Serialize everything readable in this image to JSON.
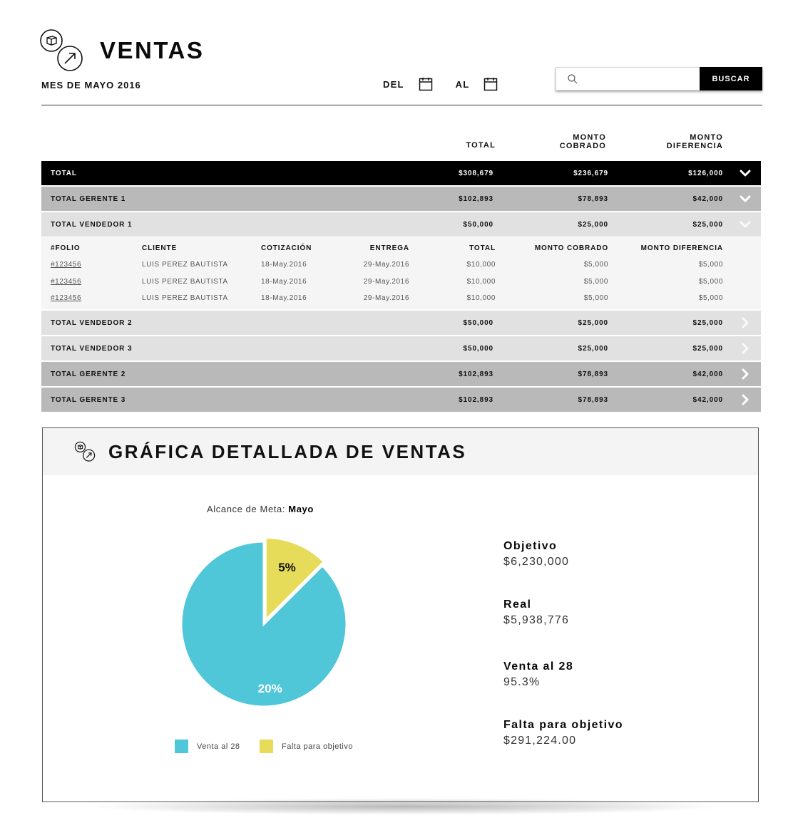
{
  "header": {
    "title": "VENTAS",
    "month": "MES DE MAYO 2016",
    "del_label": "DEL",
    "al_label": "AL",
    "search_placeholder": "",
    "search_button": "BUSCAR"
  },
  "columns": {
    "total": "TOTAL",
    "monto_cobrado_1": "MONTO",
    "monto_cobrado_2": "COBRADO",
    "monto_diferencia_1": "MONTO",
    "monto_diferencia_2": "DIFERENCIA"
  },
  "rows": [
    {
      "label": "TOTAL",
      "total": "$308,679",
      "cobrado": "$236,679",
      "diferencia": "$126,000",
      "style": "black",
      "chevron": "chevron-down-icon"
    },
    {
      "label": "TOTAL GERENTE 1",
      "total": "$102,893",
      "cobrado": "$78,893",
      "diferencia": "$42,000",
      "style": "dark",
      "chevron": "chevron-down-icon"
    },
    {
      "label": "TOTAL VENDEDOR 1",
      "total": "$50,000",
      "cobrado": "$25,000",
      "diferencia": "$25,000",
      "style": "light",
      "chevron": "chevron-down-icon"
    },
    {
      "label": "TOTAL VENDEDOR 2",
      "total": "$50,000",
      "cobrado": "$25,000",
      "diferencia": "$25,000",
      "style": "light",
      "chevron": "chevron-right-icon"
    },
    {
      "label": "TOTAL VENDEDOR 3",
      "total": "$50,000",
      "cobrado": "$25,000",
      "diferencia": "$25,000",
      "style": "light",
      "chevron": "chevron-right-icon"
    },
    {
      "label": "TOTAL GERENTE 2",
      "total": "$102,893",
      "cobrado": "$78,893",
      "diferencia": "$42,000",
      "style": "dark",
      "chevron": "chevron-right-icon"
    },
    {
      "label": "TOTAL GERENTE 3",
      "total": "$102,893",
      "cobrado": "$78,893",
      "diferencia": "$42,000",
      "style": "dark",
      "chevron": "chevron-right-icon"
    }
  ],
  "detail": {
    "headers": {
      "folio": "#FOLIO",
      "cliente": "CLIENTE",
      "cotizacion": "COTIZACIÓN",
      "entrega": "ENTREGA",
      "total": "TOTAL",
      "cobrado": "MONTO COBRADO",
      "diferencia": "MONTO DIFERENCIA"
    },
    "items": [
      {
        "folio": "#123456",
        "cliente": "LUIS PEREZ BAUTISTA",
        "cotizacion": "18-May.2016",
        "entrega": "29-May.2016",
        "total": "$10,000",
        "cobrado": "$5,000",
        "diferencia": "$5,000"
      },
      {
        "folio": "#123456",
        "cliente": "LUIS PEREZ BAUTISTA",
        "cotizacion": "18-May.2016",
        "entrega": "29-May.2016",
        "total": "$10,000",
        "cobrado": "$5,000",
        "diferencia": "$5,000"
      },
      {
        "folio": "#123456",
        "cliente": "LUIS PEREZ BAUTISTA",
        "cotizacion": "18-May.2016",
        "entrega": "29-May.2016",
        "total": "$10,000",
        "cobrado": "$5,000",
        "diferencia": "$5,000"
      }
    ]
  },
  "chart_panel": {
    "title": "GRÁFICA DETALLADA DE VENTAS",
    "caption_prefix": "Alcance de Meta:",
    "caption_month": "Mayo",
    "legend": [
      {
        "label": "Venta al 28",
        "color": "#50c7d9"
      },
      {
        "label": "Falta para objetivo",
        "color": "#e6dc5a"
      }
    ],
    "stats": [
      {
        "label": "Objetivo",
        "value": "$6,230,000"
      },
      {
        "label": "Real",
        "value": "$5,938,776"
      },
      {
        "label": "Venta al 28",
        "value": "95.3%"
      },
      {
        "label": "Falta para objetivo",
        "value": "$291,224.00"
      }
    ]
  },
  "chart_data": {
    "type": "pie",
    "title": "Alcance de Meta: Mayo",
    "slices": [
      {
        "label": "Venta al 28",
        "value": 87.5,
        "display": "20%",
        "color": "#50c7d9"
      },
      {
        "label": "Falta para objetivo",
        "value": 12.5,
        "display": "5%",
        "color": "#e6dc5a"
      }
    ],
    "legend_position": "bottom"
  }
}
